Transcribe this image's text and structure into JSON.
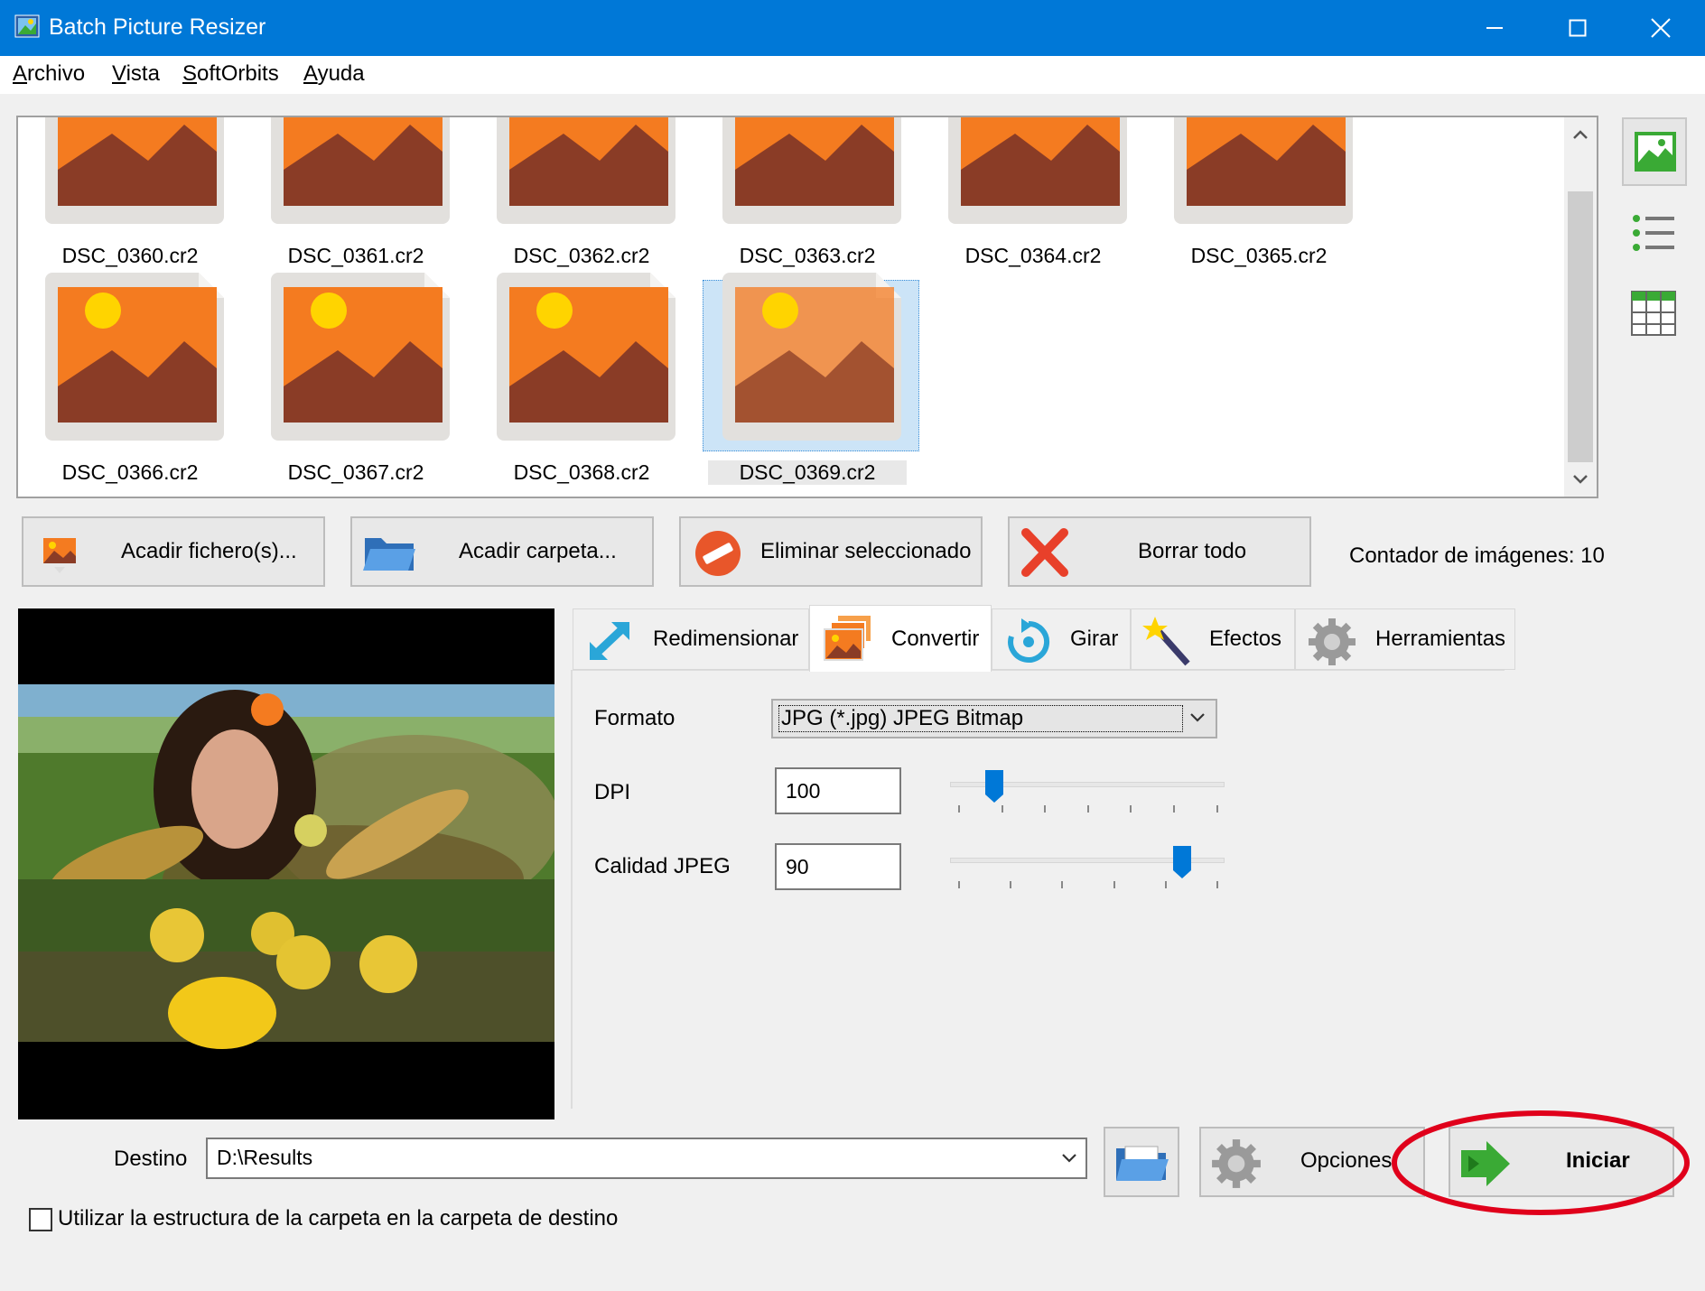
{
  "window": {
    "title": "Batch Picture Resizer",
    "icons": [
      "app-icon",
      "minimize-icon",
      "maximize-icon",
      "close-icon"
    ]
  },
  "menu": [
    "Archivo",
    "Vista",
    "SoftOrbits",
    "Ayuda"
  ],
  "thumbnails": [
    {
      "name": "DSC_0360.cr2",
      "selected": false
    },
    {
      "name": "DSC_0361.cr2",
      "selected": false
    },
    {
      "name": "DSC_0362.cr2",
      "selected": false
    },
    {
      "name": "DSC_0363.cr2",
      "selected": false
    },
    {
      "name": "DSC_0364.cr2",
      "selected": false
    },
    {
      "name": "DSC_0365.cr2",
      "selected": false
    },
    {
      "name": "DSC_0366.cr2",
      "selected": false
    },
    {
      "name": "DSC_0367.cr2",
      "selected": false
    },
    {
      "name": "DSC_0368.cr2",
      "selected": false
    },
    {
      "name": "DSC_0369.cr2",
      "selected": true
    }
  ],
  "actions": {
    "add_files": "Acadir fichero(s)...",
    "add_folder": "Acadir carpeta...",
    "remove_selected": "Eliminar seleccionado",
    "clear_all": "Borrar todo",
    "counter": "Contador de imágenes: 10"
  },
  "tabs": {
    "resize": "Redimensionar",
    "convert": "Convertir",
    "rotate": "Girar",
    "effects": "Efectos",
    "tools": "Herramientas",
    "active": "convert"
  },
  "convert": {
    "format_label": "Formato",
    "format_value": "JPG (*.jpg) JPEG Bitmap",
    "dpi_label": "DPI",
    "dpi_value": "100",
    "dpi_slider": 0.14,
    "quality_label": "Calidad JPEG",
    "quality_value": "90",
    "quality_slider": 0.86
  },
  "bottom": {
    "destination_label": "Destino",
    "destination_value": "D:\\Results",
    "options": "Opciones",
    "start": "Iniciar",
    "folder_structure_label": "Utilizar la estructura de la carpeta en la carpeta de destino",
    "folder_structure_checked": false
  },
  "colors": {
    "titlebar": "#0078d7",
    "thumb_orange": "#f47b20",
    "thumb_brown": "#8a3c26",
    "sun": "#ffd400",
    "selection": "#cce4f7",
    "highlight_ring": "#e0001b",
    "accent_green": "#3aaa35"
  }
}
